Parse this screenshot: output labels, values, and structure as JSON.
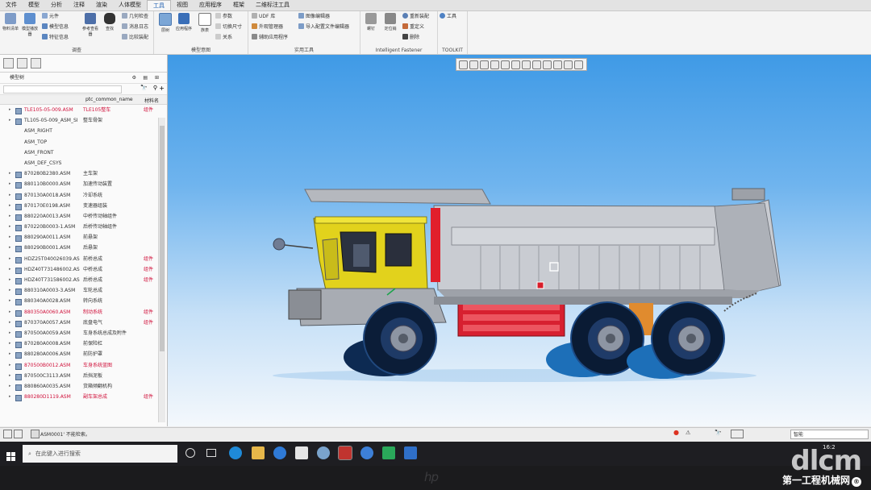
{
  "menu_tabs": [
    "文件",
    "模型",
    "分析",
    "注释",
    "渲染",
    "人体模型",
    "工具",
    "视图",
    "应用程序",
    "框架",
    "二维标注工具"
  ],
  "ribbon": {
    "groups": [
      "调查",
      "模型意图",
      "实用工具",
      "Intelligent Fastener",
      "TOOLKIT"
    ],
    "buttons": {
      "g1_big1": "物料清单",
      "g1_big2": "模型播放器",
      "g1_s1": "元件",
      "g1_s2": "模型信息",
      "g1_s3": "特征信息",
      "g1_big3": "参考查看器",
      "g1_big4": "查找",
      "g1_s4": "几何检查",
      "g1_s5": "消息日志",
      "g1_s6": "比较装配",
      "g2_big1": "层树",
      "g2_big2": "应用程序",
      "g2_big3": "关系",
      "g2_big4": "族表",
      "g2_s1": "参数",
      "g2_s2": "切换尺寸",
      "g2_s3": "关系",
      "g3_s1": "UDF 库",
      "g3_s2": "外观管理器",
      "g3_s3": "辅助应用程序",
      "g3_s4": "图像编辑器",
      "g3_s5": "导入配置文件编辑器",
      "g4_b1": "螺钉",
      "g4_b2": "定位销",
      "g4_s1": "重新装配",
      "g4_s2": "重定义",
      "g4_s3": "删除",
      "g5_s1": "工具"
    }
  },
  "tree": {
    "title": "模型树",
    "col_name": "ptc_common_name",
    "col_mat": "材料名",
    "rows": [
      {
        "name": "TLE105-05-009.ASM",
        "cn": "TLE105整车",
        "mt": "组件",
        "red": true,
        "kind": "root"
      },
      {
        "name": "TL105-05-009_ASM_SI",
        "cn": "整车骨架",
        "mt": "",
        "red": false,
        "kind": "part"
      },
      {
        "name": "ASM_RIGHT",
        "cn": "",
        "mt": "",
        "red": false,
        "kind": "plane"
      },
      {
        "name": "ASM_TOP",
        "cn": "",
        "mt": "",
        "red": false,
        "kind": "plane"
      },
      {
        "name": "ASM_FRONT",
        "cn": "",
        "mt": "",
        "red": false,
        "kind": "plane"
      },
      {
        "name": "ASM_DEF_CSYS",
        "cn": "",
        "mt": "",
        "red": false,
        "kind": "plane"
      },
      {
        "name": "870280B2380.ASM",
        "cn": "主车架",
        "mt": "",
        "red": false,
        "kind": "part"
      },
      {
        "name": "880110B0000.ASM",
        "cn": "加速传动装置",
        "mt": "",
        "red": false,
        "kind": "part"
      },
      {
        "name": "870130A0018.ASM",
        "cn": "冷却系统",
        "mt": "",
        "red": false,
        "kind": "part"
      },
      {
        "name": "870170E0198.ASM",
        "cn": "变速器组装",
        "mt": "",
        "red": false,
        "kind": "part"
      },
      {
        "name": "880220A0013.ASM",
        "cn": "中桥传动轴组件",
        "mt": "",
        "red": false,
        "kind": "part"
      },
      {
        "name": "870220B0003-1.ASM",
        "cn": "后桥传动轴组件",
        "mt": "",
        "red": false,
        "kind": "part"
      },
      {
        "name": "880290A0011.ASM",
        "cn": "前悬架",
        "mt": "",
        "red": false,
        "kind": "part"
      },
      {
        "name": "880290B0001.ASM",
        "cn": "后悬架",
        "mt": "",
        "red": false,
        "kind": "part"
      },
      {
        "name": "HDZ25T040026039.AS",
        "cn": "前桥总成",
        "mt": "组件",
        "red": false,
        "kind": "part"
      },
      {
        "name": "HDZ40T731486002.AS",
        "cn": "中桥总成",
        "mt": "组件",
        "red": false,
        "kind": "part"
      },
      {
        "name": "HDZ40T731586002.AS",
        "cn": "后桥总成",
        "mt": "组件",
        "red": false,
        "kind": "part"
      },
      {
        "name": "880310A0003-3.ASM",
        "cn": "车轮总成",
        "mt": "",
        "red": false,
        "kind": "part"
      },
      {
        "name": "880340A0028.ASM",
        "cn": "转向系统",
        "mt": "",
        "red": false,
        "kind": "part"
      },
      {
        "name": "880350A0060.ASM",
        "cn": "制动系统",
        "mt": "组件",
        "red": true,
        "kind": "part"
      },
      {
        "name": "870370A0057.ASM",
        "cn": "底盘电气",
        "mt": "组件",
        "red": false,
        "kind": "part"
      },
      {
        "name": "870500A0059.ASM",
        "cn": "车身系统总成及附件",
        "mt": "",
        "red": false,
        "kind": "part"
      },
      {
        "name": "870280A0008.ASM",
        "cn": "前保险杠",
        "mt": "",
        "red": false,
        "kind": "part"
      },
      {
        "name": "880280A0006.ASM",
        "cn": "前防护罩",
        "mt": "",
        "red": false,
        "kind": "part"
      },
      {
        "name": "870500B0012.ASM",
        "cn": "车身系统蓝图",
        "mt": "",
        "red": true,
        "kind": "part"
      },
      {
        "name": "870500C3113.ASM",
        "cn": "后挡泥板",
        "mt": "",
        "red": false,
        "kind": "part"
      },
      {
        "name": "880860A0035.ASM",
        "cn": "货箱倾翻机构",
        "mt": "",
        "red": false,
        "kind": "part"
      },
      {
        "name": "880280D1119.ASM",
        "cn": "副车架总成",
        "mt": "组件",
        "red": true,
        "kind": "part"
      }
    ]
  },
  "status": {
    "message": "ASM0001' 不能检索。",
    "filter": "智能"
  },
  "taskbar": {
    "search_placeholder": "在此键入进行搜索",
    "time": "16:2"
  },
  "watermark": {
    "logo": "dlcm",
    "text": "第一工程机械网",
    "reg": "®"
  },
  "brand": "hp"
}
